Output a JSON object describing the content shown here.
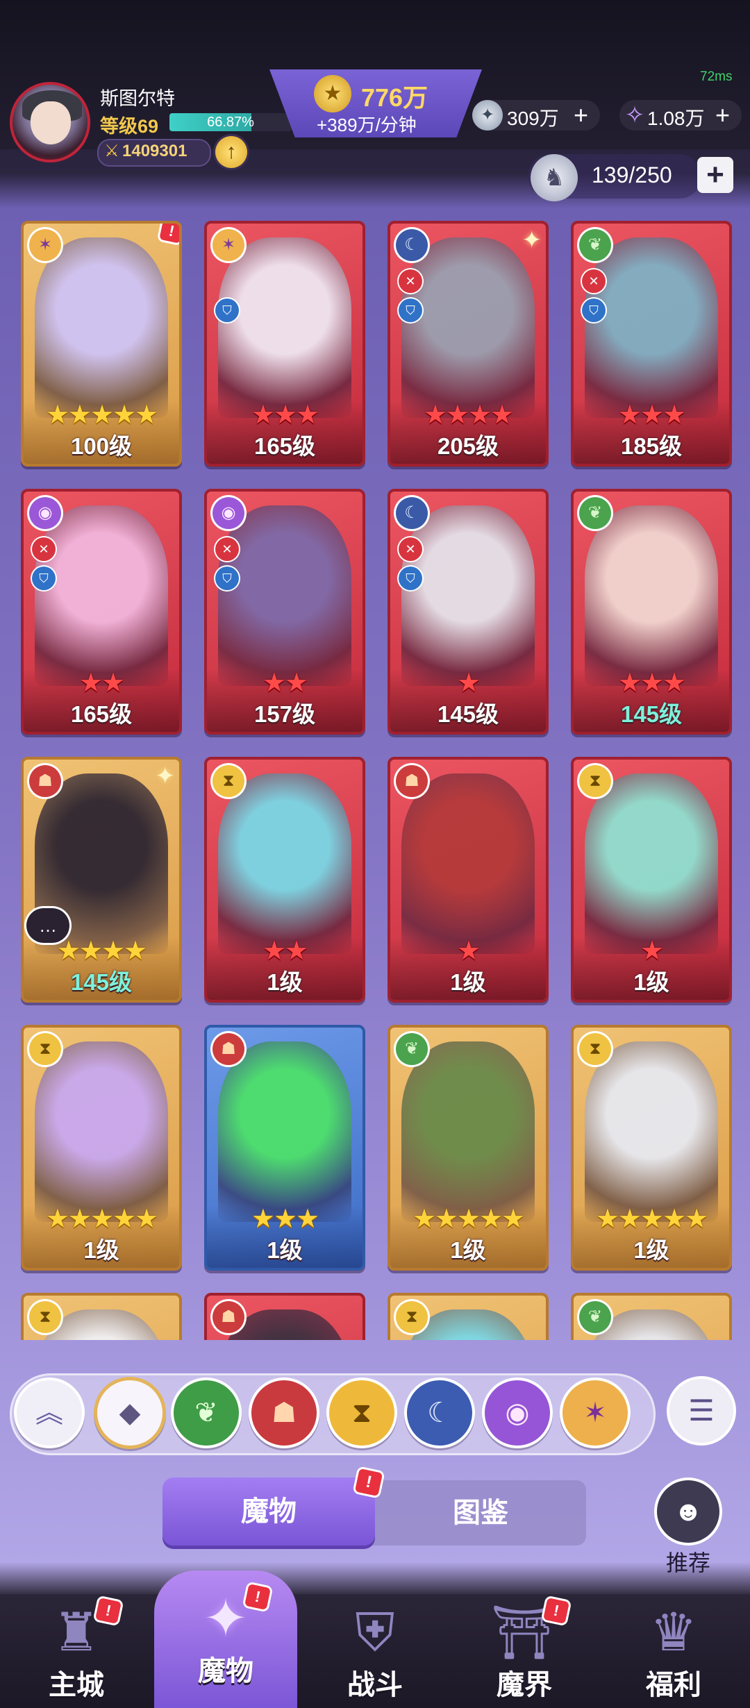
{
  "player": {
    "name": "斯图尔特",
    "level_label": "等级69",
    "xp_percent_text": "66.87%",
    "xp_fraction": 0.6687,
    "power": "1409301"
  },
  "currency": {
    "gold": "776万",
    "gold_rate": "+389万/分钟",
    "silver": "309万",
    "gems": "1.08万",
    "ping": "72ms"
  },
  "capacity": "139/250",
  "colors": {
    "card_gold": "#d99a45",
    "card_red": "#c22a3c",
    "card_blue": "#3e6cc6",
    "star_gold": "#ffd43b",
    "star_red": "#ff4a4a",
    "level_teal": "#7df1dc",
    "tab_active": "#7a55d6"
  },
  "cards": [
    {
      "frame": "gold",
      "element": "arcane-icon",
      "stars": 5,
      "star_color": "gold",
      "level": "100级",
      "alert": true
    },
    {
      "frame": "red",
      "element": "arcane-icon",
      "stars": 3,
      "star_color": "red",
      "level": "165级",
      "badges": [
        "shield"
      ]
    },
    {
      "frame": "red",
      "element": "wolf-icon",
      "stars": 4,
      "star_color": "red",
      "level": "205级",
      "badges": [
        "sword",
        "shield"
      ],
      "sparkle": true
    },
    {
      "frame": "red",
      "element": "nature-icon",
      "stars": 3,
      "star_color": "red",
      "level": "185级",
      "badges": [
        "sword",
        "shield"
      ]
    },
    {
      "frame": "red",
      "element": "eye-icon",
      "stars": 2,
      "star_color": "red",
      "level": "165级",
      "badges": [
        "sword",
        "shield"
      ]
    },
    {
      "frame": "red",
      "element": "eye-icon",
      "stars": 2,
      "star_color": "red",
      "level": "157级",
      "badges": [
        "sword",
        "shield"
      ]
    },
    {
      "frame": "red",
      "element": "wolf-icon",
      "stars": 1,
      "star_color": "red",
      "level": "145级",
      "badges": [
        "sword",
        "shield"
      ]
    },
    {
      "frame": "red",
      "element": "nature-icon",
      "stars": 3,
      "star_color": "red",
      "level": "145级",
      "level_teal": true
    },
    {
      "frame": "gold",
      "element": "beast-icon",
      "stars": 4,
      "star_color": "gold",
      "level": "145级",
      "level_teal": true,
      "chat": true,
      "sparkle": true
    },
    {
      "frame": "red",
      "element": "time-icon",
      "stars": 2,
      "star_color": "red",
      "level": "1级"
    },
    {
      "frame": "red",
      "element": "beast-icon",
      "stars": 1,
      "star_color": "red",
      "level": "1级"
    },
    {
      "frame": "red",
      "element": "time-icon",
      "stars": 1,
      "star_color": "red",
      "level": "1级"
    },
    {
      "frame": "gold",
      "element": "time-icon",
      "stars": 5,
      "star_color": "gold",
      "level": "1级"
    },
    {
      "frame": "blue",
      "element": "beast-icon",
      "stars": 3,
      "star_color": "gold",
      "level": "1级"
    },
    {
      "frame": "gold",
      "element": "nature-icon",
      "stars": 5,
      "star_color": "gold",
      "level": "1级"
    },
    {
      "frame": "gold",
      "element": "time-icon",
      "stars": 5,
      "star_color": "gold",
      "level": "1级"
    },
    {
      "frame": "gold",
      "element": "time-icon",
      "stars": 0,
      "star_color": "gold",
      "level": ""
    },
    {
      "frame": "red",
      "element": "beast-icon",
      "stars": 0,
      "star_color": "red",
      "level": ""
    },
    {
      "frame": "gold",
      "element": "time-icon",
      "stars": 0,
      "star_color": "gold",
      "level": ""
    },
    {
      "frame": "gold",
      "element": "nature-icon",
      "stars": 0,
      "star_color": "gold",
      "level": ""
    }
  ],
  "filters": [
    "collapse-icon",
    "all-icon",
    "nature-icon",
    "beast-icon",
    "time-icon",
    "wolf-icon",
    "eye-icon",
    "arcane-icon"
  ],
  "tabs": {
    "monsters": "魔物",
    "codex": "图鉴"
  },
  "recommend": "推荐",
  "nav": {
    "main_city": "主城",
    "monsters": "魔物",
    "battle": "战斗",
    "demon_realm": "魔界",
    "welfare": "福利"
  },
  "alert_mark": "!"
}
